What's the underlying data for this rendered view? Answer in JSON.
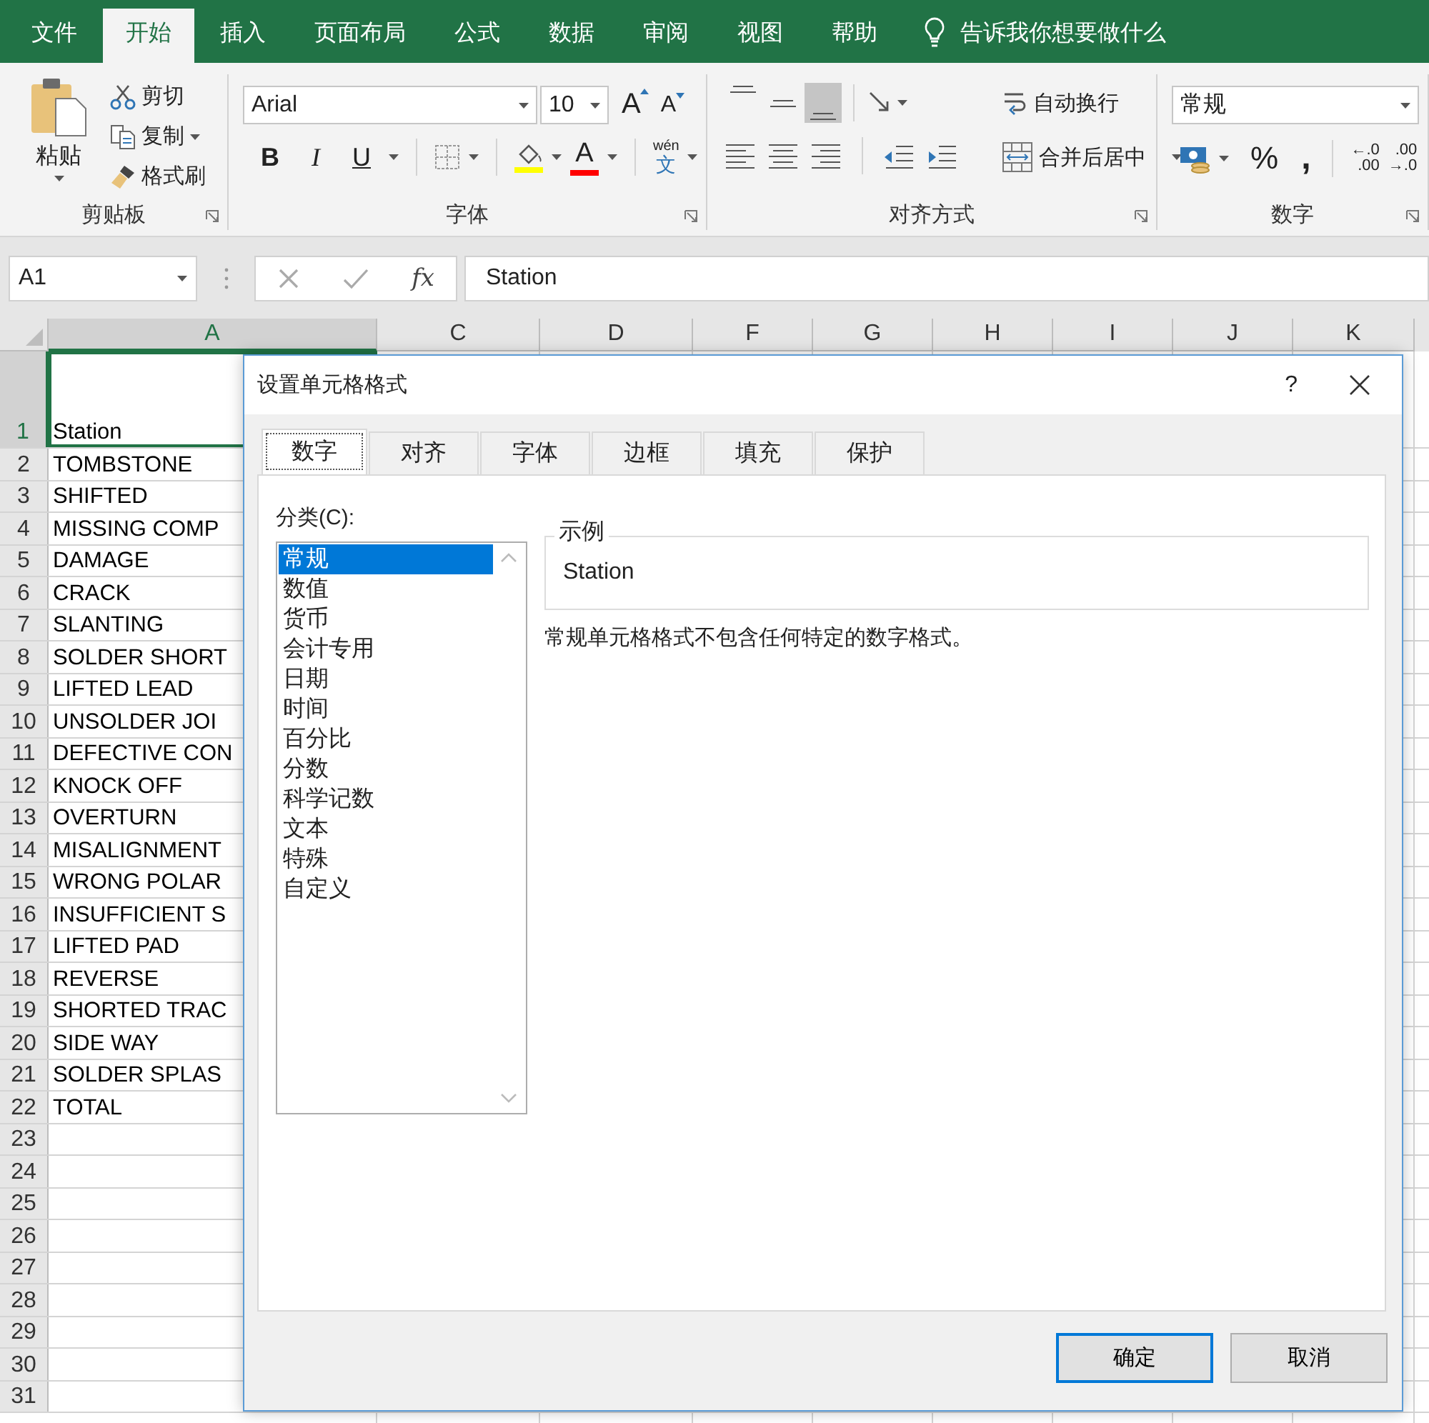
{
  "ribbon": {
    "tabs": [
      {
        "label": "文件",
        "selected": false
      },
      {
        "label": "开始",
        "selected": true
      },
      {
        "label": "插入",
        "selected": false
      },
      {
        "label": "页面布局",
        "selected": false
      },
      {
        "label": "公式",
        "selected": false
      },
      {
        "label": "数据",
        "selected": false
      },
      {
        "label": "审阅",
        "selected": false
      },
      {
        "label": "视图",
        "selected": false
      },
      {
        "label": "帮助",
        "selected": false
      }
    ],
    "tell_me": "告诉我你想要做什么",
    "clipboard": {
      "paste": "粘贴",
      "cut": "剪切",
      "copy": "复制",
      "format_painter": "格式刷",
      "label": "剪贴板"
    },
    "font": {
      "name": "Arial",
      "size": "10",
      "grow": "A",
      "shrink": "A",
      "styles": [
        {
          "kind": "bold",
          "label": "B"
        },
        {
          "kind": "italic",
          "label": "I"
        },
        {
          "kind": "underline",
          "label": "U"
        }
      ],
      "fill_color": {
        "color": "#ffff00"
      },
      "font_color": {
        "label": "A",
        "color": "#ff0000"
      },
      "phonetic": {
        "top": "wén",
        "bottom": "文"
      },
      "label": "字体"
    },
    "alignment": {
      "vertical": [
        {
          "kind": "top",
          "selected": false
        },
        {
          "kind": "middle",
          "selected": false
        },
        {
          "kind": "bottom",
          "selected": true
        }
      ],
      "wrap_text": "自动换行",
      "merge_center": "合并后居中",
      "label": "对齐方式"
    },
    "number": {
      "format": "常规",
      "percent": "%",
      "comma": ",",
      "increase_decimal": [
        "←.0",
        ".00"
      ],
      "decrease_decimal": [
        ".00",
        "→.0"
      ],
      "label": "数字"
    }
  },
  "formula_bar": {
    "name_box": "A1",
    "fx": "fx",
    "value": "Station"
  },
  "sheet": {
    "columns": [
      {
        "label": "A",
        "selected": true
      },
      {
        "label": "C",
        "selected": false
      },
      {
        "label": "D",
        "selected": false
      },
      {
        "label": "F",
        "selected": false
      },
      {
        "label": "G",
        "selected": false
      },
      {
        "label": "H",
        "selected": false
      },
      {
        "label": "I",
        "selected": false
      },
      {
        "label": "J",
        "selected": false
      },
      {
        "label": "K",
        "selected": false
      }
    ],
    "rows": [
      {
        "number": "1",
        "cell": "Station",
        "selected": true
      },
      {
        "number": "2",
        "cell": "TOMBSTONE",
        "selected": false
      },
      {
        "number": "3",
        "cell": "SHIFTED",
        "selected": false
      },
      {
        "number": "4",
        "cell": "MISSING COMP",
        "selected": false
      },
      {
        "number": "5",
        "cell": "DAMAGE",
        "selected": false
      },
      {
        "number": "6",
        "cell": "CRACK",
        "selected": false
      },
      {
        "number": "7",
        "cell": "SLANTING",
        "selected": false
      },
      {
        "number": "8",
        "cell": "SOLDER SHORT",
        "selected": false
      },
      {
        "number": "9",
        "cell": "LIFTED LEAD",
        "selected": false
      },
      {
        "number": "10",
        "cell": "UNSOLDER JOI",
        "selected": false
      },
      {
        "number": "11",
        "cell": "DEFECTIVE CON",
        "selected": false
      },
      {
        "number": "12",
        "cell": "KNOCK OFF",
        "selected": false
      },
      {
        "number": "13",
        "cell": "OVERTURN",
        "selected": false
      },
      {
        "number": "14",
        "cell": "MISALIGNMENT",
        "selected": false
      },
      {
        "number": "15",
        "cell": "WRONG POLAR",
        "selected": false
      },
      {
        "number": "16",
        "cell": "INSUFFICIENT S",
        "selected": false
      },
      {
        "number": "17",
        "cell": "LIFTED PAD",
        "selected": false
      },
      {
        "number": "18",
        "cell": "REVERSE",
        "selected": false
      },
      {
        "number": "19",
        "cell": "SHORTED TRAC",
        "selected": false
      },
      {
        "number": "20",
        "cell": "SIDE WAY",
        "selected": false
      },
      {
        "number": "21",
        "cell": "SOLDER SPLAS",
        "selected": false
      },
      {
        "number": "22",
        "cell": "TOTAL",
        "selected": false
      },
      {
        "number": "23",
        "selected": false
      },
      {
        "number": "24",
        "selected": false
      },
      {
        "number": "25",
        "selected": false
      },
      {
        "number": "26",
        "selected": false
      },
      {
        "number": "27",
        "selected": false
      },
      {
        "number": "28",
        "selected": false
      },
      {
        "number": "29",
        "selected": false
      },
      {
        "number": "30",
        "selected": false
      },
      {
        "number": "31",
        "selected": false
      }
    ]
  },
  "dialog": {
    "title": "设置单元格格式",
    "help": "?",
    "tabs": [
      {
        "label": "数字",
        "selected": true
      },
      {
        "label": "对齐",
        "selected": false
      },
      {
        "label": "字体",
        "selected": false
      },
      {
        "label": "边框",
        "selected": false
      },
      {
        "label": "填充",
        "selected": false
      },
      {
        "label": "保护",
        "selected": false
      }
    ],
    "category_label": "分类(C):",
    "categories": [
      {
        "label": "常规",
        "selected": true
      },
      {
        "label": "数值",
        "selected": false
      },
      {
        "label": "货币",
        "selected": false
      },
      {
        "label": "会计专用",
        "selected": false
      },
      {
        "label": "日期",
        "selected": false
      },
      {
        "label": "时间",
        "selected": false
      },
      {
        "label": "百分比",
        "selected": false
      },
      {
        "label": "分数",
        "selected": false
      },
      {
        "label": "科学记数",
        "selected": false
      },
      {
        "label": "文本",
        "selected": false
      },
      {
        "label": "特殊",
        "selected": false
      },
      {
        "label": "自定义",
        "selected": false
      }
    ],
    "sample_label": "示例",
    "sample_value": "Station",
    "description": "常规单元格格式不包含任何特定的数字格式。",
    "buttons": [
      {
        "label": "确定",
        "default": true
      },
      {
        "label": "取消",
        "default": false
      }
    ]
  }
}
